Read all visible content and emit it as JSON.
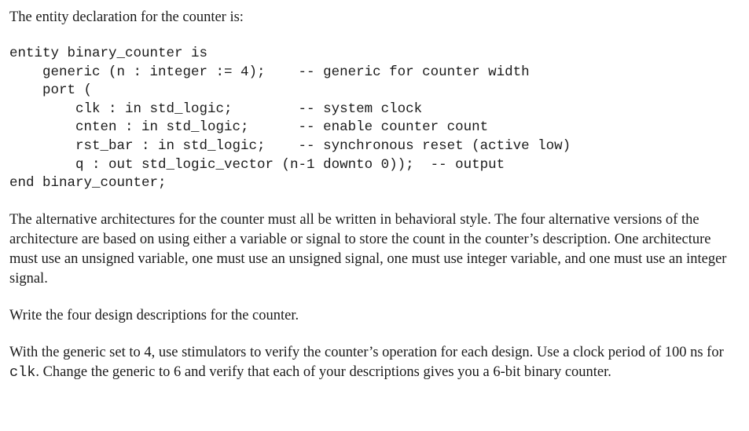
{
  "intro": "The entity declaration for the counter is:",
  "code": {
    "l1": "entity binary_counter is",
    "l2": "    generic (n : integer := 4);    -- generic for counter width",
    "l3": "    port (",
    "l4": "        clk : in std_logic;        -- system clock",
    "l5": "        cnten : in std_logic;      -- enable counter count",
    "l6": "        rst_bar : in std_logic;    -- synchronous reset (active low)",
    "l7": "        q : out std_logic_vector (n-1 downto 0));  -- output",
    "l8": "end binary_counter;"
  },
  "para1": "The alternative architectures for the counter must all be written in behavioral style. The four alter­native versions of the architecture are based on using either a variable or signal to store the count in the counter’s description. One architecture must use an unsigned variable, one must use an unsigned signal, one must use integer variable, and one must use an integer signal.",
  "para2": "Write the four design descriptions for the counter.",
  "para3_a": "With the generic set to 4, use stimulators to verify the counter’s operation for each design. Use a clock period of 100 ns for ",
  "para3_clk": "clk",
  "para3_b": ". Change the generic to 6 and verify that each of your descriptions gives you a 6-bit binary counter."
}
